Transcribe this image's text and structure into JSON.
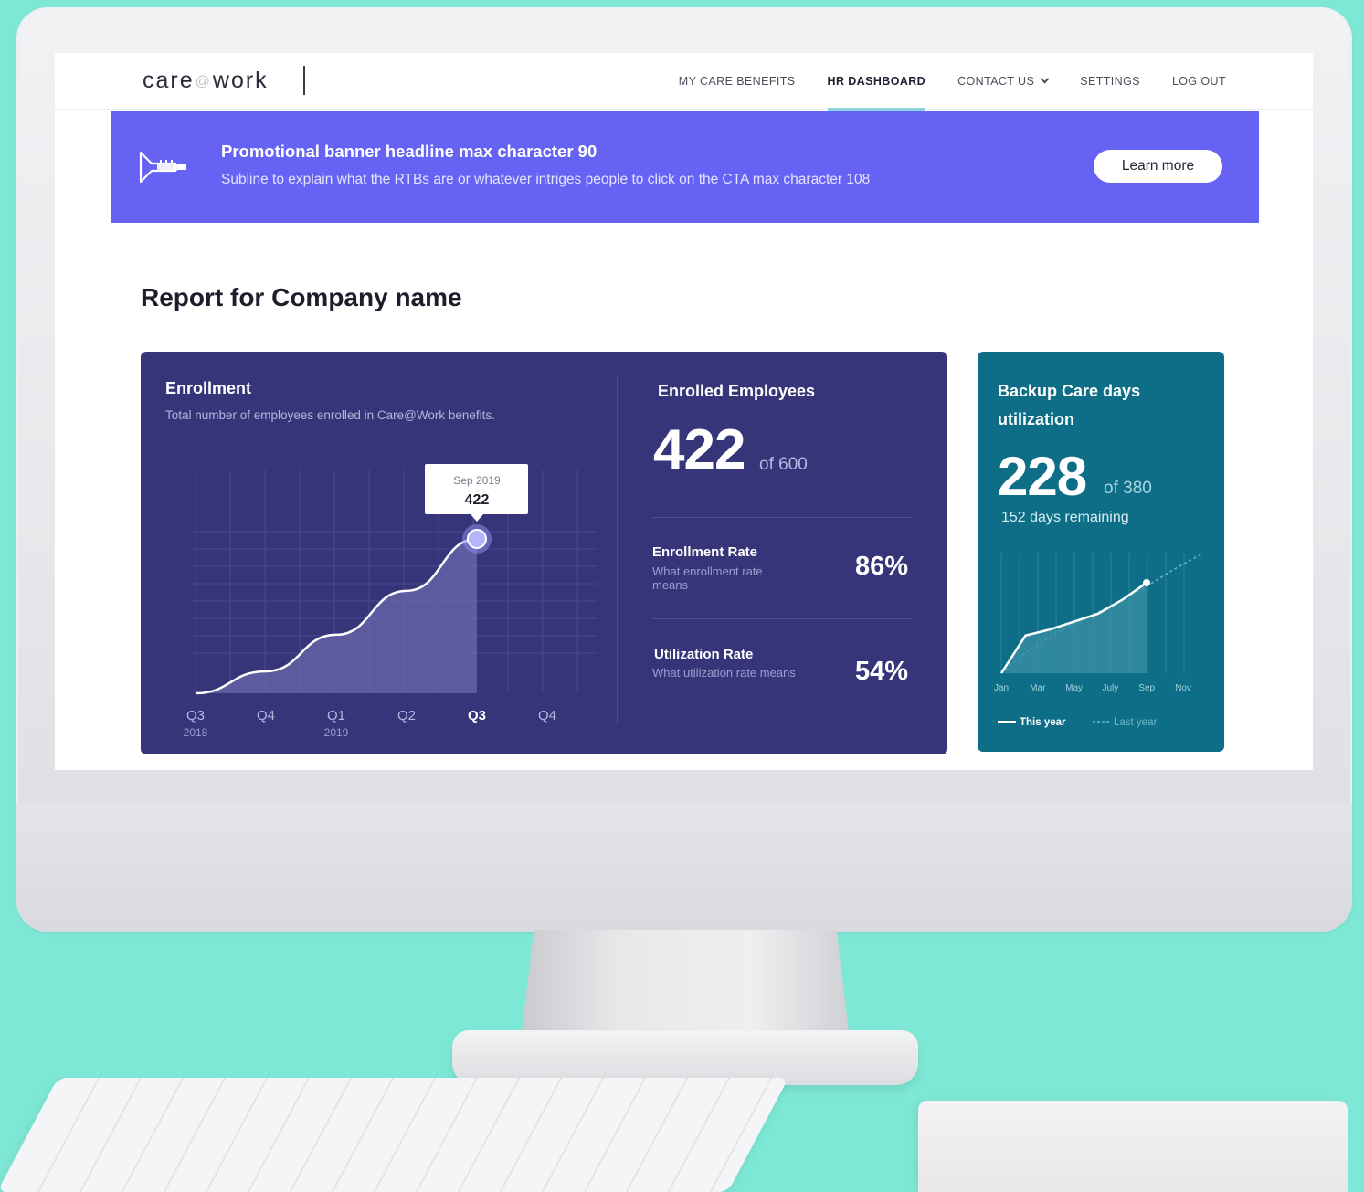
{
  "nav": {
    "logo_left": "care",
    "logo_at": "@",
    "logo_right": "work",
    "items": [
      {
        "label": "MY CARE BENEFITS"
      },
      {
        "label": "HR DASHBOARD",
        "active": true
      },
      {
        "label": "CONTACT US"
      },
      {
        "label": "SETTINGS"
      },
      {
        "label": "LOG OUT"
      }
    ]
  },
  "banner": {
    "headline": "Promotional banner headline max character 90",
    "subline": "Subline to explain what the RTBs are or whatever intriges people to click on the CTA max character 108",
    "cta_label": "Learn more",
    "icon": "trumpet-icon"
  },
  "report": {
    "title": "Report for Company name"
  },
  "enrollment": {
    "title": "Enrollment",
    "subtitle": "Total number of employees enrolled in Care@Work benefits.",
    "tooltip": {
      "date": "Sep 2019",
      "value": "422"
    }
  },
  "enrolled_employees": {
    "title": "Enrolled Employees",
    "value": "422",
    "of_text": "of 600",
    "enrollment_rate": {
      "label": "Enrollment Rate",
      "desc": "What enrollment rate means",
      "value": "86%"
    },
    "utilization_rate": {
      "label": "Utilization Rate",
      "desc": "What utilization rate means",
      "value": "54%"
    }
  },
  "backup_care": {
    "title": "Backup Care days utilization",
    "value": "228",
    "of_text": "of 380",
    "remaining": "152 days remaining",
    "legend_this_year": "This year",
    "legend_last_year": "Last year"
  },
  "colors": {
    "banner": "#6562f4",
    "card_main": "#37357a",
    "card_side": "#0e6e87",
    "background": "#7ee8d6"
  },
  "chart_data": [
    {
      "type": "area",
      "title": "Enrollment",
      "x": [
        "Q3",
        "Q4",
        "Q1",
        "Q2",
        "Q3",
        "Q4"
      ],
      "x_sublabels": [
        "2018",
        "",
        "2019",
        "",
        "",
        ""
      ],
      "series": [
        {
          "values": [
            0,
            60,
            160,
            280,
            422,
            null
          ]
        }
      ],
      "highlight": {
        "x": "Q3",
        "label": "Sep 2019",
        "value": 422
      },
      "ylim": [
        0,
        600
      ],
      "grid": true
    },
    {
      "type": "line",
      "title": "Backup Care days utilization",
      "x": [
        "Jan",
        "Mar",
        "May",
        "July",
        "Sep",
        "Nov"
      ],
      "series": [
        {
          "name": "This year",
          "values": [
            0,
            95,
            110,
            130,
            150,
            185,
            228
          ]
        },
        {
          "name": "Last year",
          "values": [
            0,
            60,
            105,
            140,
            175,
            215,
            260,
            300
          ]
        }
      ],
      "ylim": [
        0,
        380
      ],
      "legend": "bottom"
    }
  ]
}
